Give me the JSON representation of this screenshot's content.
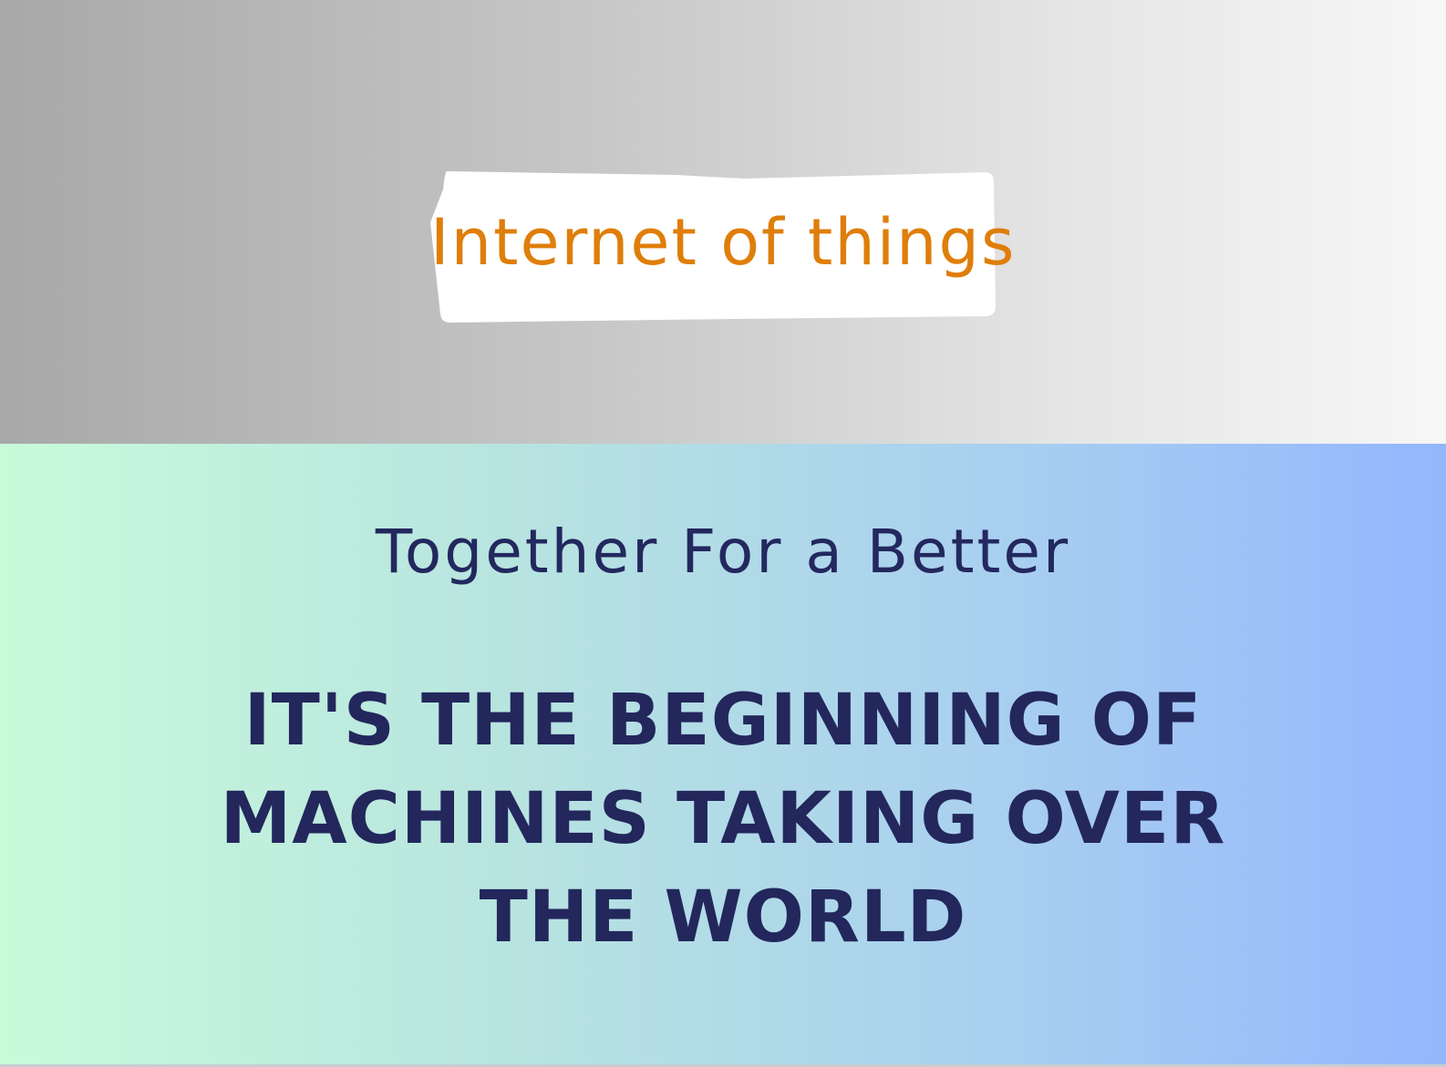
{
  "header": {
    "title": "Internet of things",
    "title_color": "#df7e0a",
    "card_color": "#ffffff",
    "background_gradient": [
      "#a8a8a8",
      "#f7f7f7"
    ]
  },
  "content": {
    "subtitle": "Together For a Better",
    "headline": "IT'S THE BEGINNING OF MACHINES TAKING OVER THE WORLD",
    "text_color": "#23275c",
    "background_gradient": [
      "#c8fbda",
      "#94b6fd"
    ]
  }
}
